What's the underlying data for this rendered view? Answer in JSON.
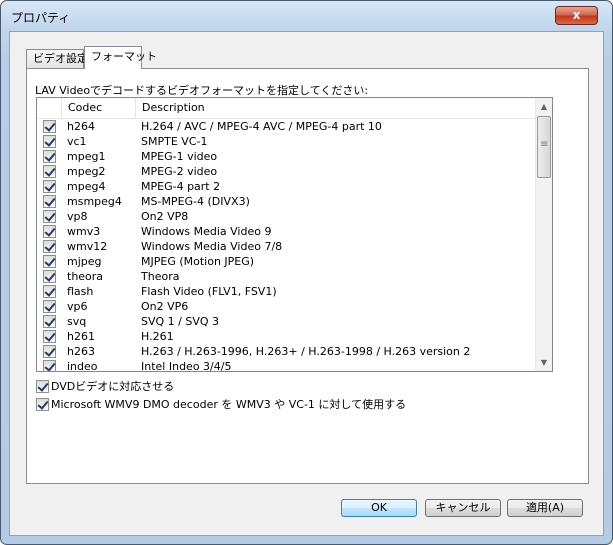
{
  "window": {
    "title": "プロパティ",
    "close_glyph": "x"
  },
  "tabs": [
    {
      "label": "ビデオ設定",
      "active": false
    },
    {
      "label": "フォーマット",
      "active": true
    }
  ],
  "intro_text": "LAV Videoでデコードするビデオフォーマットを指定してください:",
  "list": {
    "columns": [
      "",
      "Codec",
      "Description"
    ],
    "rows": [
      {
        "codec": "h264",
        "description": "H.264 / AVC / MPEG-4 AVC / MPEG-4 part 10",
        "checked": true
      },
      {
        "codec": "vc1",
        "description": "SMPTE VC-1",
        "checked": true
      },
      {
        "codec": "mpeg1",
        "description": "MPEG-1 video",
        "checked": true
      },
      {
        "codec": "mpeg2",
        "description": "MPEG-2 video",
        "checked": true
      },
      {
        "codec": "mpeg4",
        "description": "MPEG-4 part 2",
        "checked": true
      },
      {
        "codec": "msmpeg4",
        "description": "MS-MPEG-4 (DIVX3)",
        "checked": true
      },
      {
        "codec": "vp8",
        "description": "On2 VP8",
        "checked": true
      },
      {
        "codec": "wmv3",
        "description": "Windows Media Video 9",
        "checked": true
      },
      {
        "codec": "wmv12",
        "description": "Windows Media Video 7/8",
        "checked": true
      },
      {
        "codec": "mjpeg",
        "description": "MJPEG (Motion JPEG)",
        "checked": true
      },
      {
        "codec": "theora",
        "description": "Theora",
        "checked": true
      },
      {
        "codec": "flash",
        "description": "Flash Video (FLV1, FSV1)",
        "checked": true
      },
      {
        "codec": "vp6",
        "description": "On2 VP6",
        "checked": true
      },
      {
        "codec": "svq",
        "description": "SVQ 1 / SVQ 3",
        "checked": true
      },
      {
        "codec": "h261",
        "description": "H.261",
        "checked": true
      },
      {
        "codec": "h263",
        "description": "H.263 / H.263-1996, H.263+ / H.263-1998 / H.263 version 2",
        "checked": true
      },
      {
        "codec": "indeo",
        "description": "Intel Indeo 3/4/5",
        "checked": true
      }
    ]
  },
  "options": {
    "dvd_video": {
      "label": "DVDビデオに対応させる",
      "checked": true
    },
    "wmv9_dmo": {
      "label": "Microsoft WMV9 DMO decoder を WMV3 や VC-1 に対して使用する",
      "checked": true
    }
  },
  "buttons": {
    "ok": "OK",
    "cancel": "キャンセル",
    "apply": "適用(A)"
  }
}
